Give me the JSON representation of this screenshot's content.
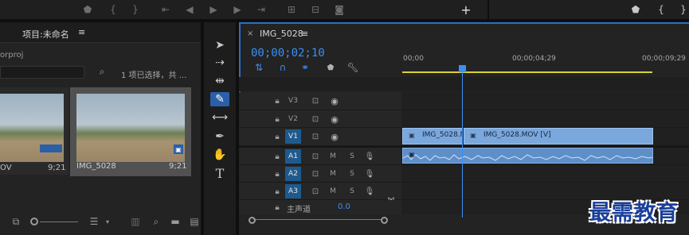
{
  "project": {
    "title": "项目:未命名",
    "menu_icon": "≡",
    "file_name_fragment": "orproj",
    "selection_text": "1 项已选择，共 ...",
    "items": [
      {
        "name": "OV",
        "duration": "9;21"
      },
      {
        "name": "IMG_5028",
        "duration": "9;21"
      }
    ]
  },
  "sequence": {
    "close_icon": "×",
    "name": "IMG_5028",
    "menu_icon": "≡",
    "timecode": "00;00;02;10",
    "ruler": [
      "00;00",
      "00;00;04;29",
      "00;00;09;29"
    ],
    "video_tracks": [
      {
        "label": "V3",
        "active": false
      },
      {
        "label": "V2",
        "active": false
      },
      {
        "label": "V1",
        "active": true
      }
    ],
    "audio_tracks": [
      {
        "label": "A1",
        "active": true
      },
      {
        "label": "A2",
        "active": true
      },
      {
        "label": "A3",
        "active": true
      }
    ],
    "mute_label": "M",
    "solo_label": "S",
    "master_label": "主声道",
    "master_value": "0.0",
    "clips": {
      "video_a": "IMG_5028.M",
      "video_b": "IMG_5028.MOV [V]"
    }
  },
  "colors": {
    "accent": "#2d6ec6",
    "playhead": "#3b8ff5",
    "clip_video": "#7aa7dc",
    "clip_audio": "#5f8fc9",
    "workarea": "#d8d23a"
  },
  "watermark": "最需教育"
}
